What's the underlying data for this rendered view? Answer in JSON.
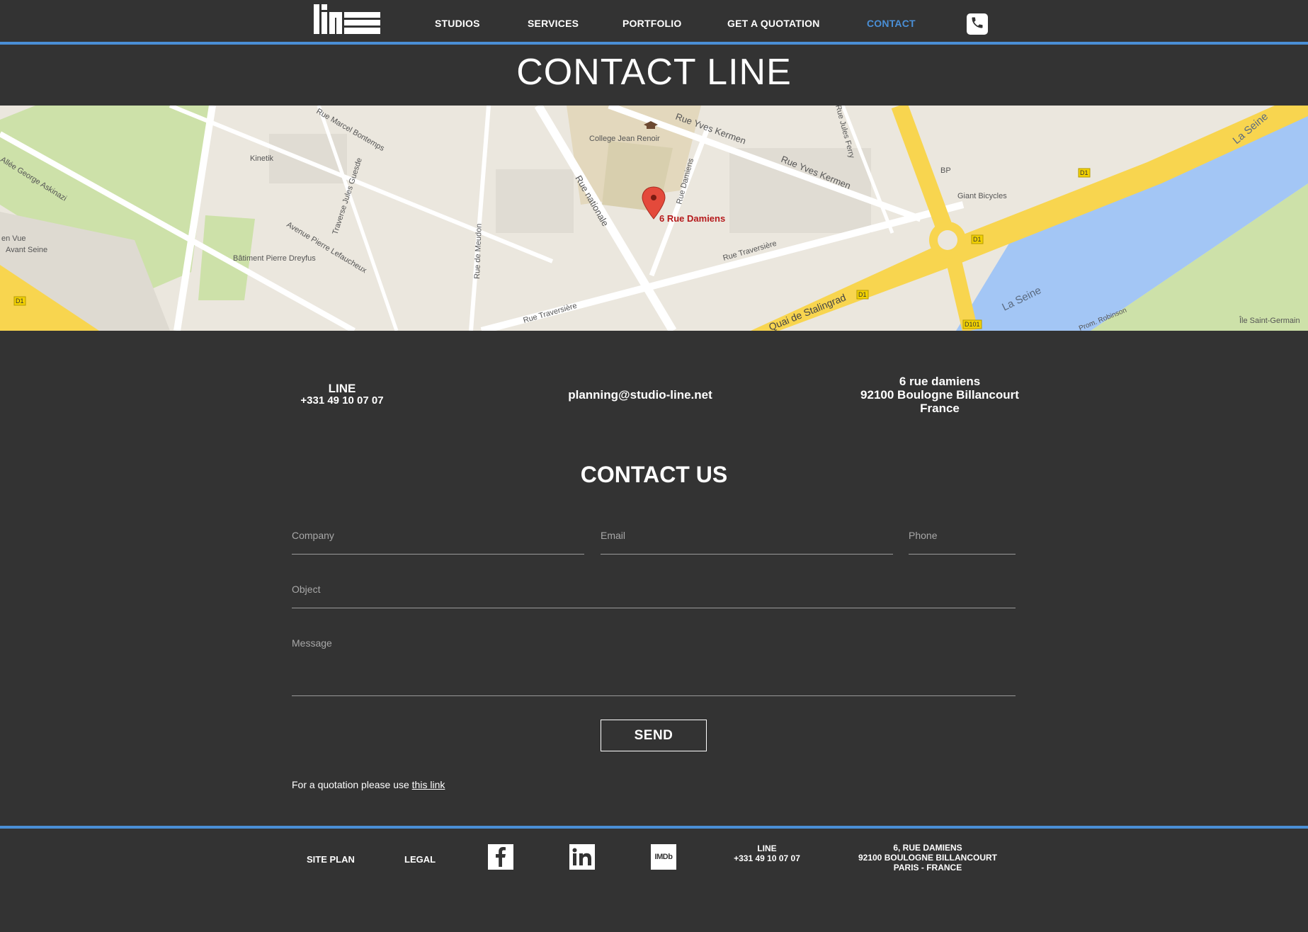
{
  "nav": {
    "logo_text": "line",
    "items": [
      {
        "label": "STUDIOS"
      },
      {
        "label": "SERVICES"
      },
      {
        "label": "PORTFOLIO"
      },
      {
        "label": "GET A QUOTATION"
      },
      {
        "label": "CONTACT",
        "active": true
      }
    ],
    "phone_icon": "phone-icon"
  },
  "page_title": "CONTACT LINE",
  "map": {
    "marker_label": "6 Rue Damiens",
    "labels": {
      "college": "College Jean Renoir",
      "kinetik": "Kinetik",
      "batiment": "Bâtiment Pierre Dreyfus",
      "allee": "Allée George Askinazi",
      "en_vue": "en Vue",
      "avant_seine": "Avant Seine",
      "marcel": "Rue Marcel Bontemps",
      "traverse_guesde": "Traverse Jules Guesde",
      "lefaucheux": "Avenue Pierre Lefaucheux",
      "meudon": "Rue de Meudon",
      "nationale": "Rue nationale",
      "damiens_street": "Rue Damiens",
      "kermen1": "Rue Yves Kermen",
      "kermen2": "Rue Yves Kermen",
      "traversiere1": "Rue Traversière",
      "traversiere2": "Rue Traversière",
      "jules_ferry": "Rue Jules Ferry",
      "stalingrad": "Quai de Stalingrad",
      "bp": "BP",
      "giant": "Giant Bicycles",
      "la_seine1": "La Seine",
      "la_seine2": "La Seine",
      "ile": "Île Saint-Germain",
      "robinson": "Prom. Robinson",
      "d1": "D1",
      "d101": "D101"
    }
  },
  "info": {
    "company": "LINE",
    "phone": "+331 49 10 07 07",
    "email": "planning@studio-line.net",
    "address_line1": "6 rue damiens",
    "address_line2": "92100 Boulogne Billancourt",
    "address_line3": "France"
  },
  "form": {
    "heading": "CONTACT US",
    "company_placeholder": "Company",
    "email_placeholder": "Email",
    "phone_placeholder": "Phone",
    "object_placeholder": "Object",
    "message_placeholder": "Message",
    "send_label": "SEND",
    "quote_text": "For a quotation please use ",
    "quote_link": "this link"
  },
  "footer": {
    "site_plan": "SITE PLAN",
    "legal": "LEGAL",
    "social": [
      "facebook-icon",
      "linkedin-icon",
      "imdb-icon"
    ],
    "imdb_text": "IMDb",
    "company": "LINE",
    "phone": "+331 49 10 07 07",
    "address_line1": "6, RUE DAMIENS",
    "address_line2": "92100 BOULOGNE BILLANCOURT",
    "address_line3": "PARIS - FRANCE"
  },
  "colors": {
    "background": "#333333",
    "accent": "#4a8fd6",
    "text": "#ffffff"
  }
}
